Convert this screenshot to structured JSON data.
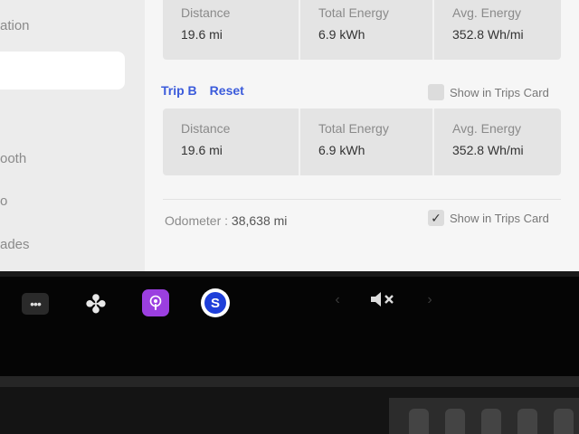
{
  "sidebar": {
    "items": [
      {
        "label": "ation"
      },
      {
        "label": "ooth"
      },
      {
        "label": "o"
      },
      {
        "label": "ades"
      }
    ]
  },
  "trip_a": {
    "stats": [
      {
        "title": "Distance",
        "value": "19.6 mi"
      },
      {
        "title": "Total Energy",
        "value": "6.9 kWh"
      },
      {
        "title": "Avg. Energy",
        "value": "352.8 Wh/mi"
      }
    ]
  },
  "trip_b": {
    "label": "Trip B",
    "reset_label": "Reset",
    "show_in_trips_label": "Show in Trips Card",
    "show_in_trips_checked": false,
    "stats": [
      {
        "title": "Distance",
        "value": "19.6 mi"
      },
      {
        "title": "Total Energy",
        "value": "6.9 kWh"
      },
      {
        "title": "Avg. Energy",
        "value": "352.8 Wh/mi"
      }
    ]
  },
  "odometer": {
    "label": "Odometer :",
    "value": "38,638 mi",
    "show_in_trips_label": "Show in Trips Card",
    "show_in_trips_checked": true
  },
  "dock": {
    "icons": [
      "more-icon",
      "fan-icon",
      "podcast-icon",
      "s-app-icon",
      "chevron-left-icon",
      "mute-icon",
      "chevron-right-icon"
    ],
    "more_glyph": "•••",
    "fan_glyph": "✤",
    "podcast_glyph": "◉",
    "s_glyph": "S",
    "chev_left_glyph": "‹",
    "chev_right_glyph": "›",
    "mute_glyph": "◀✕"
  },
  "colors": {
    "accent": "#3b5bdb",
    "podcast": "#9b3fe0",
    "s_app": "#1f3fd9"
  }
}
